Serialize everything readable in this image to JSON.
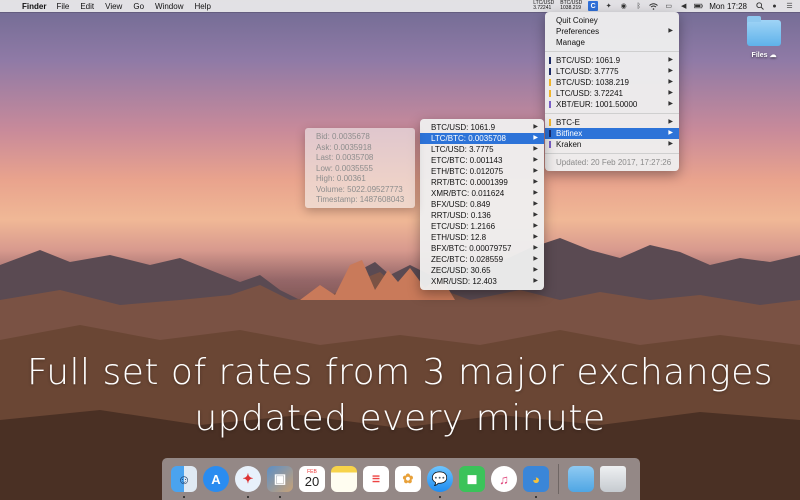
{
  "menubar": {
    "apple": "",
    "app": "Finder",
    "items": [
      "File",
      "Edit",
      "View",
      "Go",
      "Window",
      "Help"
    ],
    "ticker1": {
      "pair": "LTC/USD",
      "value": "3.72241"
    },
    "ticker2": {
      "pair": "BTC/USD",
      "value": "1038.219"
    },
    "coiney_icon": "C",
    "clock": "Mon 17:28"
  },
  "main_menu": {
    "quit": "Quit Coiney",
    "preferences": "Preferences",
    "manage": "Manage",
    "favorites": [
      {
        "label": "BTC/USD: 1061.9",
        "color": "#1d2a66"
      },
      {
        "label": "LTC/USD: 3.7775",
        "color": "#1d2a66"
      },
      {
        "label": "BTC/USD: 1038.219",
        "color": "#f0b429"
      },
      {
        "label": "LTC/USD: 3.72241",
        "color": "#f0b429"
      },
      {
        "label": "XBT/EUR: 1001.50000",
        "color": "#7a5fc8"
      }
    ],
    "exchanges": [
      {
        "label": "BTC-E",
        "color": "#f0b429"
      },
      {
        "label": "Bitfinex",
        "color": "#1d2a66"
      },
      {
        "label": "Kraken",
        "color": "#7a5fc8"
      }
    ],
    "updated": "Updated: 20 Feb 2017, 17:27:26"
  },
  "pairs_menu": {
    "items": [
      "BTC/USD: 1061.9",
      "LTC/BTC: 0.0035708",
      "LTC/USD: 3.7775",
      "ETC/BTC: 0.001143",
      "ETH/BTC: 0.012075",
      "RRT/BTC: 0.0001399",
      "XMR/BTC: 0.011624",
      "BFX/USD: 0.849",
      "RRT/USD: 0.136",
      "ETC/USD: 1.2166",
      "ETH/USD: 12.8",
      "BFX/BTC: 0.00079757",
      "ZEC/BTC: 0.028559",
      "ZEC/USD: 30.65",
      "XMR/USD: 12.403"
    ]
  },
  "info_panel": {
    "bid": "Bid: 0.0035678",
    "ask": "Ask: 0.0035918",
    "last": "Last: 0.0035708",
    "low": "Low: 0.0035555",
    "high": "High: 0.00361",
    "volume": "Volume: 5022.09527773",
    "timestamp": "Timestamp: 1487608043"
  },
  "desktop": {
    "file_label": "Files"
  },
  "headline": {
    "line1": "Full set of rates from 3 major exchanges",
    "line2": "updated every minute"
  },
  "dock": {
    "calendar_month": "FEB",
    "calendar_day": "20"
  }
}
